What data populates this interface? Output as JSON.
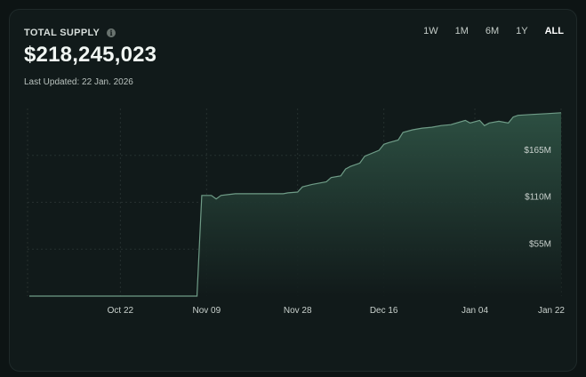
{
  "header": {
    "title": "TOTAL SUPPLY",
    "info_icon": "i",
    "value": "$218,245,023",
    "last_updated": "Last Updated: 22 Jan. 2026"
  },
  "ranges": [
    {
      "label": "1W",
      "active": false
    },
    {
      "label": "1M",
      "active": false
    },
    {
      "label": "6M",
      "active": false
    },
    {
      "label": "1Y",
      "active": false
    },
    {
      "label": "ALL",
      "active": true
    }
  ],
  "colors": {
    "line": "#6f9c87",
    "fill_top": "#2e5244",
    "fill_bottom": "#111a1a",
    "grid": "#26302f"
  },
  "chart_data": {
    "type": "area",
    "title": "",
    "xlabel": "",
    "ylabel": "",
    "x_ticks": [
      "Oct 22",
      "Nov 09",
      "Nov 28",
      "Dec 16",
      "Jan 04",
      "Jan 22"
    ],
    "y_ticks": [
      "$55M",
      "$110M",
      "$165M"
    ],
    "y_tick_values": [
      55,
      110,
      165
    ],
    "ylim": [
      0,
      220
    ],
    "y_unit": "$M",
    "grid": true,
    "series": [
      {
        "values": [
          [
            "Oct 3",
            0
          ],
          [
            "Nov 7",
            0
          ],
          [
            "Nov 7",
            2
          ],
          [
            "Nov 8",
            118
          ],
          [
            "Nov 10",
            118
          ],
          [
            "Nov 11",
            114
          ],
          [
            "Nov 12",
            118
          ],
          [
            "Nov 15",
            120
          ],
          [
            "Nov 25",
            120
          ],
          [
            "Nov 26",
            121
          ],
          [
            "Nov 28",
            122
          ],
          [
            "Nov 29",
            128
          ],
          [
            "Dec 1",
            131
          ],
          [
            "Dec 4",
            134
          ],
          [
            "Dec 5",
            139
          ],
          [
            "Dec 7",
            141
          ],
          [
            "Dec 8",
            149
          ],
          [
            "Dec 9",
            152
          ],
          [
            "Dec 11",
            156
          ],
          [
            "Dec 12",
            164
          ],
          [
            "Dec 15",
            171
          ],
          [
            "Dec 16",
            178
          ],
          [
            "Dec 17",
            180
          ],
          [
            "Dec 19",
            183
          ],
          [
            "Dec 20",
            192
          ],
          [
            "Dec 22",
            195
          ],
          [
            "Dec 24",
            197
          ],
          [
            "Dec 26",
            198
          ],
          [
            "Dec 28",
            200
          ],
          [
            "Dec 30",
            201
          ],
          [
            "Jan 2",
            206
          ],
          [
            "Jan 3",
            203
          ],
          [
            "Jan 5",
            206
          ],
          [
            "Jan 6",
            200
          ],
          [
            "Jan 7",
            203
          ],
          [
            "Jan 9",
            205
          ],
          [
            "Jan 11",
            203
          ],
          [
            "Jan 12",
            210
          ],
          [
            "Jan 13",
            212
          ],
          [
            "Jan 16",
            213
          ],
          [
            "Jan 19",
            214
          ],
          [
            "Jan 22",
            215
          ]
        ]
      }
    ]
  }
}
